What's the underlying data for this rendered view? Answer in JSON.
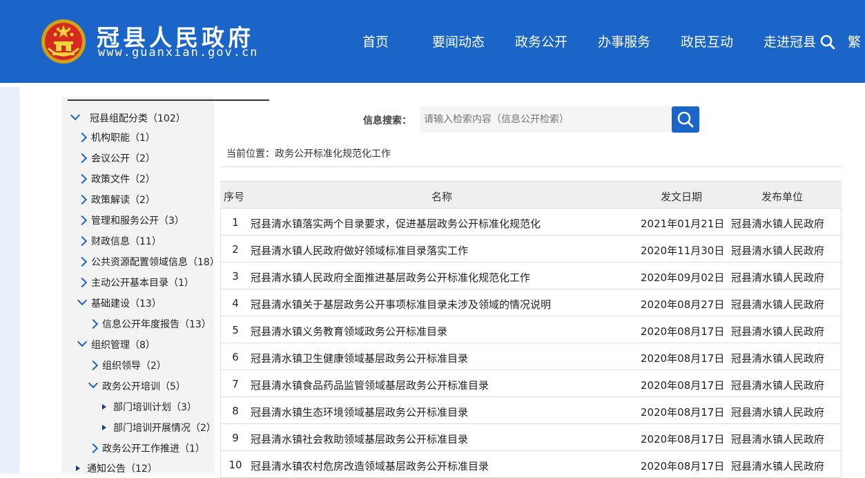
{
  "header": {
    "site_title": "冠县人民政府",
    "site_url": "www.guanxian.gov.cn",
    "nav": [
      "首页",
      "要闻动态",
      "政务公开",
      "办事服务",
      "政民互动",
      "走进冠县"
    ],
    "trad_label": "繁",
    "bg_color": "#1a65c7"
  },
  "sidebar": {
    "items": [
      {
        "label": "冠县组配分类（102）",
        "icon": "chevron-down-icon"
      },
      {
        "label": "机构职能（1）",
        "icon": "chevron-right-icon"
      },
      {
        "label": "会议公开（2）",
        "icon": "chevron-right-icon"
      },
      {
        "label": "政策文件（2）",
        "icon": "chevron-right-icon"
      },
      {
        "label": "政策解读（2）",
        "icon": "chevron-right-icon"
      },
      {
        "label": "管理和服务公开（3）",
        "icon": "chevron-right-icon"
      },
      {
        "label": "财政信息（11）",
        "icon": "chevron-right-icon"
      },
      {
        "label": "公共资源配置领域信息（18）",
        "icon": "chevron-right-icon"
      },
      {
        "label": "主动公开基本目录（1）",
        "icon": "chevron-right-icon"
      },
      {
        "label": "基础建设（13）",
        "icon": "chevron-down-icon"
      },
      {
        "label": "信息公开年度报告（13）",
        "icon": "chevron-right-icon"
      },
      {
        "label": "组织管理（8）",
        "icon": "chevron-down-icon"
      },
      {
        "label": "组织领导（2）",
        "icon": "chevron-right-icon"
      },
      {
        "label": "政务公开培训（5）",
        "icon": "chevron-down-icon"
      },
      {
        "label": "部门培训计划（3）",
        "icon": "triangle-right-icon"
      },
      {
        "label": "部门培训开展情况（2）",
        "icon": "triangle-right-icon"
      },
      {
        "label": "政务公开工作推进（1）",
        "icon": "chevron-right-icon"
      },
      {
        "label": "通知公告（12）",
        "icon": "triangle-right-icon"
      }
    ]
  },
  "search": {
    "label": "信息搜索：",
    "placeholder": "请输入检索内容（信息公开检索）"
  },
  "breadcrumb": "当前位置：政务公开标准化规范化工作",
  "table": {
    "headers": [
      "序号",
      "名称",
      "发文日期",
      "发布单位"
    ],
    "rows": [
      {
        "no": "1",
        "title": "冠县清水镇落实两个目录要求，促进基层政务公开标准化规范化",
        "date": "2021年01月21日",
        "unit": "冠县清水镇人民政府"
      },
      {
        "no": "2",
        "title": "冠县清水镇人民政府做好领域标准目录落实工作",
        "date": "2020年11月30日",
        "unit": "冠县清水镇人民政府"
      },
      {
        "no": "3",
        "title": "冠县清水镇人民政府全面推进基层政务公开标准化规范化工作",
        "date": "2020年09月02日",
        "unit": "冠县清水镇人民政府"
      },
      {
        "no": "4",
        "title": "冠县清水镇关于基层政务公开事项标准目录未涉及领域的情况说明",
        "date": "2020年08月27日",
        "unit": "冠县清水镇人民政府"
      },
      {
        "no": "5",
        "title": "冠县清水镇义务教育领域政务公开标准目录",
        "date": "2020年08月17日",
        "unit": "冠县清水镇人民政府"
      },
      {
        "no": "6",
        "title": "冠县清水镇卫生健康领域基层政务公开标准目录",
        "date": "2020年08月17日",
        "unit": "冠县清水镇人民政府"
      },
      {
        "no": "7",
        "title": "冠县清水镇食品药品监管领域基层政务公开标准目录",
        "date": "2020年08月17日",
        "unit": "冠县清水镇人民政府"
      },
      {
        "no": "8",
        "title": "冠县清水镇生态环境领域基层政务公开标准目录",
        "date": "2020年08月17日",
        "unit": "冠县清水镇人民政府"
      },
      {
        "no": "9",
        "title": "冠县清水镇社会救助领域基层政务公开标准目录",
        "date": "2020年08月17日",
        "unit": "冠县清水镇人民政府"
      },
      {
        "no": "10",
        "title": "冠县清水镇农村危房改造领域基层政务公开标准目录",
        "date": "2020年08月17日",
        "unit": "冠县清水镇人民政府"
      }
    ]
  }
}
